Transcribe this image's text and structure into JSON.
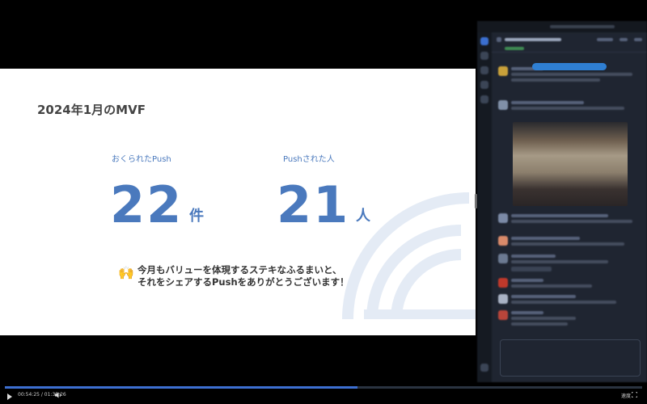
{
  "slide": {
    "title": "2024年1月のMVF",
    "stats": [
      {
        "label": "おくられたPush",
        "value": "22",
        "unit": "件"
      },
      {
        "label": "Pushされた人",
        "value": "21",
        "unit": "人"
      }
    ],
    "message": {
      "emoji": "🙌",
      "line1": "今月もバリューを体現するステキなふるまいと、",
      "line2": "それをシェアするPushをありがとうございます！"
    }
  },
  "player": {
    "time": "00:54:25 / 01:38:26",
    "progress": 0.553,
    "speed": "速度"
  },
  "colors": {
    "accent": "#4a79bd",
    "progress": "#3d6fd1",
    "chat_bg": "#1f2531"
  },
  "icons": {
    "play": "play-icon",
    "volume": "volume-icon",
    "fullscreen": "fullscreen-icon"
  }
}
